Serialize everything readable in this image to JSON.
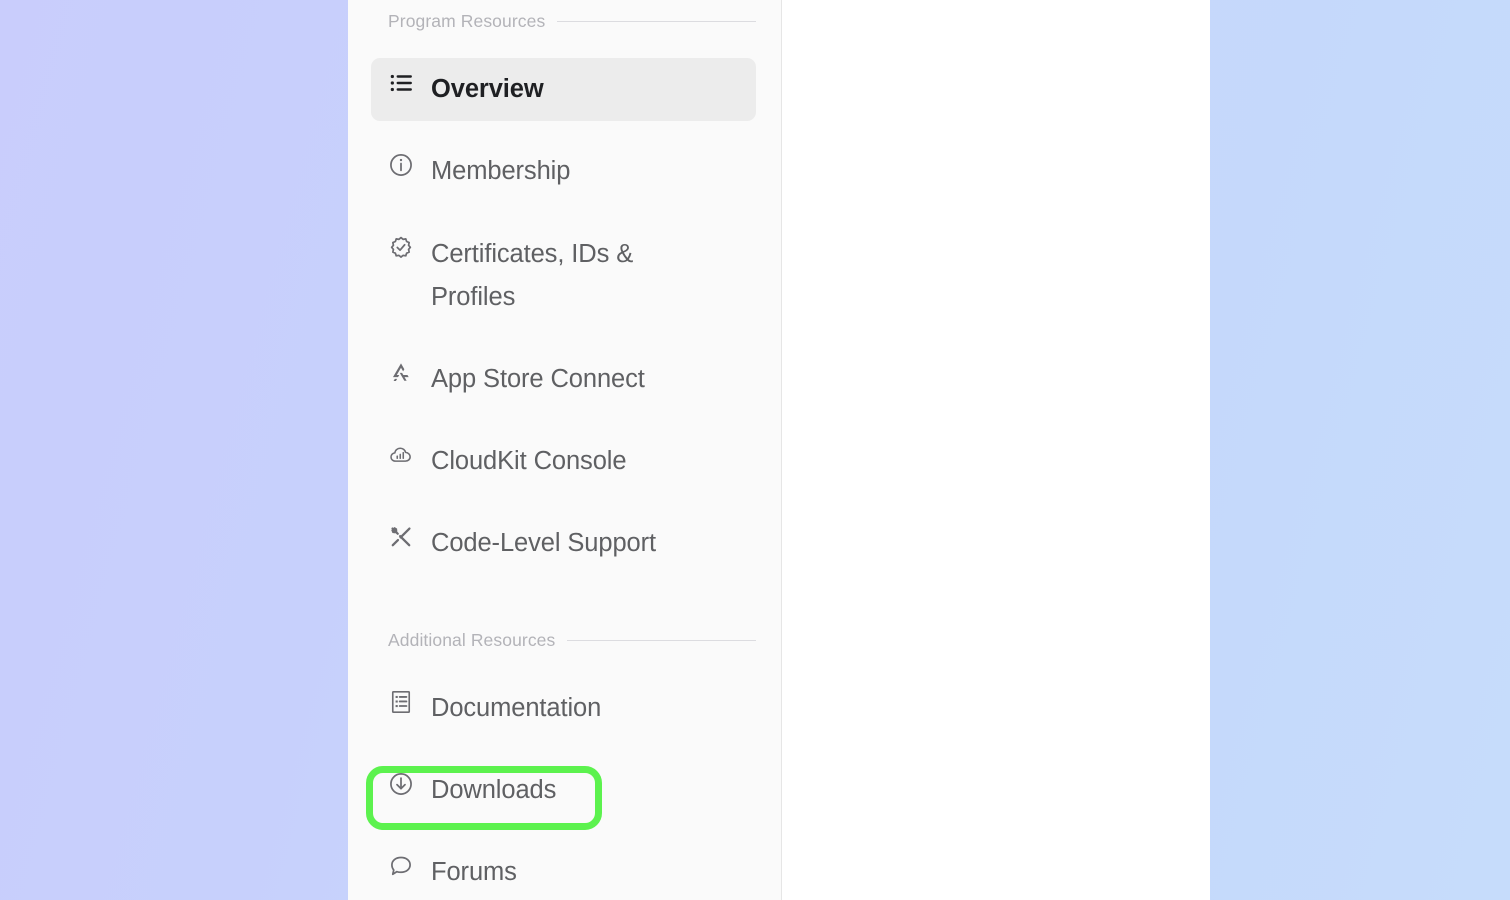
{
  "background": {
    "gradient_from": "#c9cdfc",
    "gradient_to": "#c6dcfb"
  },
  "sidebar": {
    "background": "#fafafa",
    "sections": [
      {
        "title": "Program Resources",
        "items": [
          {
            "label": "Overview",
            "icon": "list-icon",
            "selected": true
          },
          {
            "label": "Membership",
            "icon": "info-circle-icon",
            "selected": false
          },
          {
            "label": "Certificates, IDs & Profiles",
            "icon": "certificate-badge-icon",
            "selected": false
          },
          {
            "label": "App Store Connect",
            "icon": "app-store-icon",
            "selected": false
          },
          {
            "label": "CloudKit Console",
            "icon": "cloud-chart-icon",
            "selected": false
          },
          {
            "label": "Code-Level Support",
            "icon": "tools-icon",
            "selected": false
          }
        ]
      },
      {
        "title": "Additional Resources",
        "items": [
          {
            "label": "Documentation",
            "icon": "document-list-icon",
            "selected": false
          },
          {
            "label": "Downloads",
            "icon": "download-circle-icon",
            "selected": false
          },
          {
            "label": "Forums",
            "icon": "speech-bubble-icon",
            "selected": false
          }
        ]
      }
    ]
  },
  "annotation": {
    "target": "Downloads",
    "color": "#5cf24e"
  }
}
